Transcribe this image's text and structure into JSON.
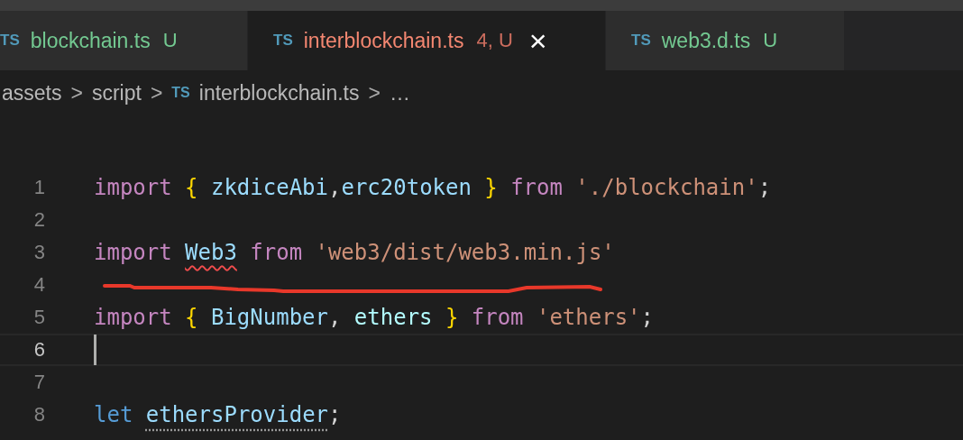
{
  "tabs": [
    {
      "icon": "TS",
      "label": "blockchain.ts",
      "status": "U",
      "kind": "untracked",
      "selected": false
    },
    {
      "icon": "TS",
      "label": "interblockchain.ts",
      "status": "4, U",
      "kind": "error",
      "selected": true,
      "close": "×"
    },
    {
      "icon": "TS",
      "label": "web3.d.ts",
      "status": "U",
      "kind": "untracked",
      "selected": false
    }
  ],
  "breadcrumb": [
    {
      "label": "assets"
    },
    {
      "label": "script"
    },
    {
      "icon": "TS",
      "label": "interblockchain.ts"
    },
    {
      "label": "…"
    }
  ],
  "breadcrumb_separator": ">",
  "lines": [
    {
      "number": "1",
      "current": false,
      "words": [
        [
          {
            "kind": "keyword",
            "text": "import"
          }
        ],
        [
          {
            "kind": "brace",
            "text": "{"
          }
        ],
        [
          {
            "kind": "variable",
            "text": "zkdiceAbi"
          },
          {
            "kind": "plain",
            "text": ","
          },
          {
            "kind": "variable",
            "text": "erc20token"
          }
        ],
        [
          {
            "kind": "brace",
            "text": "}"
          }
        ],
        [
          {
            "kind": "keyword",
            "text": "from"
          }
        ],
        [
          {
            "kind": "string",
            "text": "'./blockchain'"
          },
          {
            "kind": "plain",
            "text": ";"
          }
        ]
      ]
    },
    {
      "number": "2",
      "current": false
    },
    {
      "number": "3",
      "current": false,
      "words": [
        [
          {
            "kind": "keyword",
            "text": "import"
          }
        ],
        [
          {
            "kind": "variable",
            "text": "Web3",
            "error": true
          }
        ],
        [
          {
            "kind": "keyword",
            "text": "from"
          }
        ],
        [
          {
            "kind": "string",
            "text": "'web3/dist/web3.min.js'"
          }
        ]
      ]
    },
    {
      "number": "4",
      "current": false
    },
    {
      "number": "5",
      "current": false,
      "words": [
        [
          {
            "kind": "keyword",
            "text": "import"
          }
        ],
        [
          {
            "kind": "brace",
            "text": "{"
          }
        ],
        [
          {
            "kind": "variable",
            "text": "BigNumber"
          },
          {
            "kind": "plain",
            "text": ","
          }
        ],
        [
          {
            "kind": "bright",
            "text": "ethers"
          }
        ],
        [
          {
            "kind": "brace",
            "text": "}"
          }
        ],
        [
          {
            "kind": "keyword",
            "text": "from"
          }
        ],
        [
          {
            "kind": "string",
            "text": "'ethers'"
          },
          {
            "kind": "plain",
            "text": ";"
          }
        ]
      ]
    },
    {
      "number": "6",
      "current": true
    },
    {
      "number": "7",
      "current": false
    },
    {
      "number": "8",
      "current": false,
      "words": [
        [
          {
            "kind": "storage",
            "text": "let"
          }
        ],
        [
          {
            "kind": "variable",
            "text": "ethersProvider",
            "hint": true
          },
          {
            "kind": "plain",
            "text": ";"
          }
        ]
      ]
    }
  ]
}
